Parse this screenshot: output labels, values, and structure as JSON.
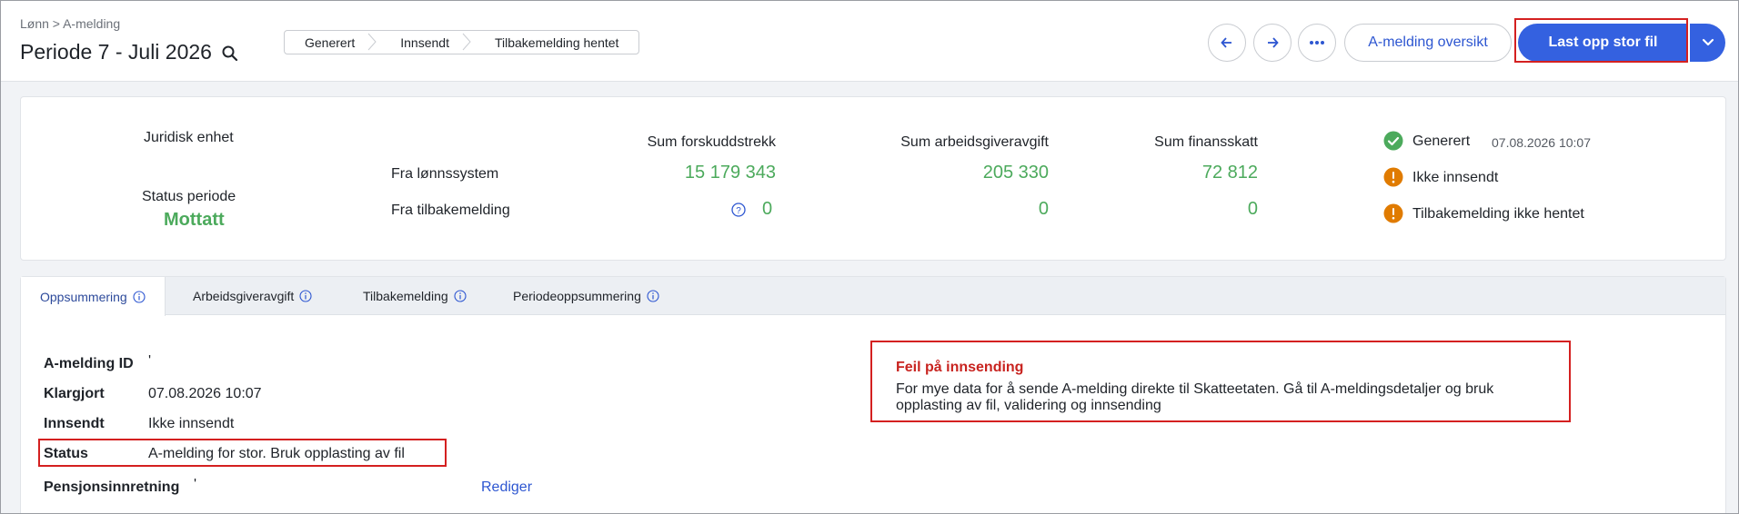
{
  "header": {
    "breadcrumb": "Lønn > A-melding",
    "title": "Periode 7 - Juli 2026",
    "steps": [
      "Generert",
      "Innsendt",
      "Tilbakemelding hentet"
    ],
    "overview_button": "A-melding oversikt",
    "upload_button": "Last opp stor fil"
  },
  "summary": {
    "legal_entity_label": "Juridisk enhet",
    "status_period_label": "Status periode",
    "status_period_value": "Mottatt",
    "row_from_payroll": "Fra lønnssystem",
    "row_from_feedback": "Fra tilbakemelding",
    "columns": [
      {
        "label": "Sum forskuddstrekk",
        "payroll": "15 179 343",
        "feedback": "0"
      },
      {
        "label": "Sum arbeidsgiveravgift",
        "payroll": "205 330",
        "feedback": "0"
      },
      {
        "label": "Sum finansskatt",
        "payroll": "72 812",
        "feedback": "0"
      }
    ],
    "statuses": [
      {
        "label": "Generert",
        "timestamp": "07.08.2026 10:07",
        "state": "done"
      },
      {
        "label": "Ikke innsendt",
        "state": "warning"
      },
      {
        "label": "Tilbakemelding ikke hentet",
        "state": "warning"
      }
    ]
  },
  "tabs": [
    "Oppsummering",
    "Arbeidsgiveravgift",
    "Tilbakemelding",
    "Periodeoppsummering"
  ],
  "details": {
    "amelding_id_label": "A-melding ID",
    "amelding_id_value": "'",
    "ready_label": "Klargjort",
    "ready_value": "07.08.2026 10:07",
    "submitted_label": "Innsendt",
    "submitted_value": "Ikke innsendt",
    "status_label": "Status",
    "status_value": "A-melding for stor. Bruk opplasting av fil",
    "pension_label": "Pensjonsinnretning",
    "pension_value": "'",
    "edit_link": "Rediger"
  },
  "error": {
    "title": "Feil på innsending",
    "message": "For mye data for å sende A-melding direkte til Skatteetaten. Gå til A-meldingsdetaljer og bruk opplasting av fil, validering og innsending"
  },
  "colors": {
    "primary": "#3461e0",
    "success": "#4caa5c",
    "warning": "#e07b00",
    "error": "#c8231f",
    "highlight": "#d42020"
  }
}
